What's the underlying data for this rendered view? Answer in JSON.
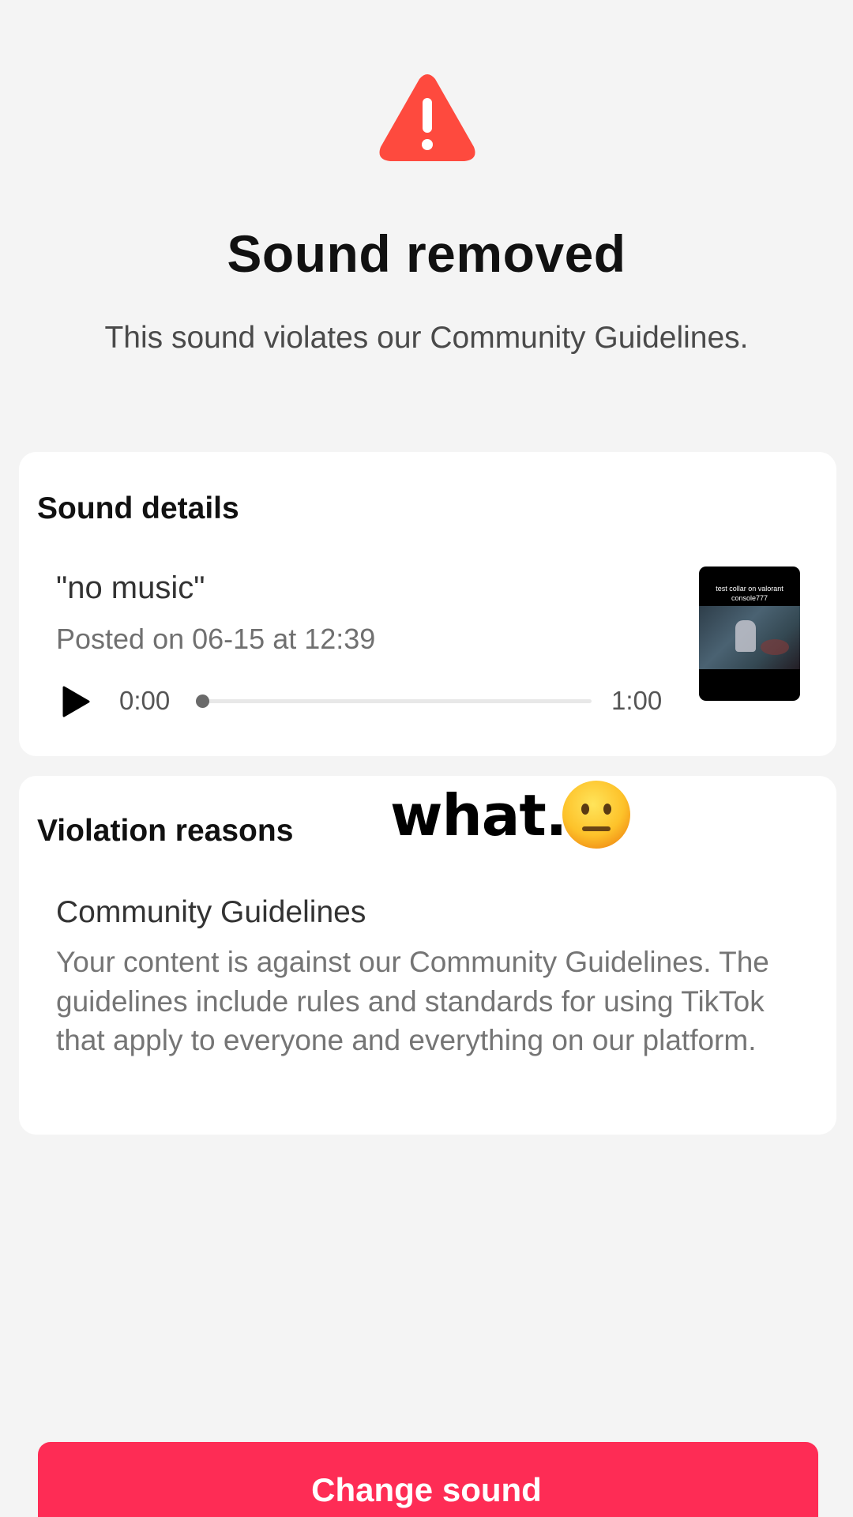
{
  "header": {
    "icon": "warning-triangle-icon",
    "title": "Sound removed",
    "subtitle": "This sound violates our Community Guidelines."
  },
  "sound_details": {
    "heading": "Sound details",
    "name": "\"no music\"",
    "posted": "Posted on 06-15 at 12:39",
    "current_time": "0:00",
    "total_time": "1:00",
    "progress_fraction": 0,
    "thumbnail_caption_line1": "test collar on valorant",
    "thumbnail_caption_line2": "console777"
  },
  "overlay": {
    "caption": "what.",
    "emoji": "neutral-face-emoji"
  },
  "violation": {
    "heading": "Violation reasons",
    "title": "Community Guidelines",
    "body": "Your content is against our Community Guidelines. The guidelines include rules and standards for using TikTok that apply to everyone and everything on our platform."
  },
  "footer": {
    "button_label": "Change sound"
  },
  "colors": {
    "background": "#f4f4f4",
    "card": "#ffffff",
    "warning": "#fe4a3e",
    "primary_button": "#fe2c55"
  }
}
